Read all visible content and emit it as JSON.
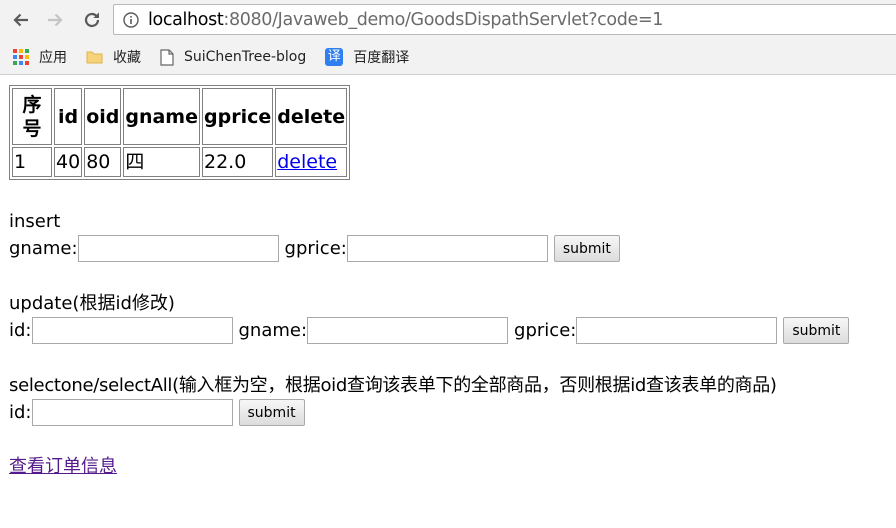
{
  "browser": {
    "url_host": "localhost",
    "url_rest": ":8080/Javaweb_demo/GoodsDispathServlet?code=1",
    "bookmarks": [
      {
        "label": "应用",
        "icon": "apps-grid-icon"
      },
      {
        "label": "收藏",
        "icon": "folder-icon"
      },
      {
        "label": "SuiChenTree-blog",
        "icon": "page-icon"
      },
      {
        "label": "百度翻译",
        "icon": "translate-icon",
        "icon_text": "译"
      }
    ]
  },
  "table": {
    "headers": {
      "seq": "序号",
      "id": "id",
      "oid": "oid",
      "gname": "gname",
      "gprice": "gprice",
      "delete": "delete"
    },
    "rows": [
      {
        "seq": "1",
        "id": "40",
        "oid": "80",
        "gname": "四",
        "gprice": "22.0",
        "delete": "delete"
      }
    ]
  },
  "insert": {
    "title": "insert",
    "gname_label": "gname:",
    "gprice_label": "gprice:",
    "submit": "submit"
  },
  "update": {
    "title": "update(根据id修改)",
    "id_label": "id:",
    "gname_label": "gname:",
    "gprice_label": "gprice:",
    "submit": "submit"
  },
  "select": {
    "title": "selectone/selectAll(输入框为空，根据oid查询该表单下的全部商品，否则根据id查该表单的商品)",
    "id_label": "id:",
    "submit": "submit"
  },
  "order_link": "查看订单信息",
  "colors": {
    "link": "#0000ee",
    "visited_link": "#551a8b",
    "chrome_bg": "#f2f2f2"
  }
}
